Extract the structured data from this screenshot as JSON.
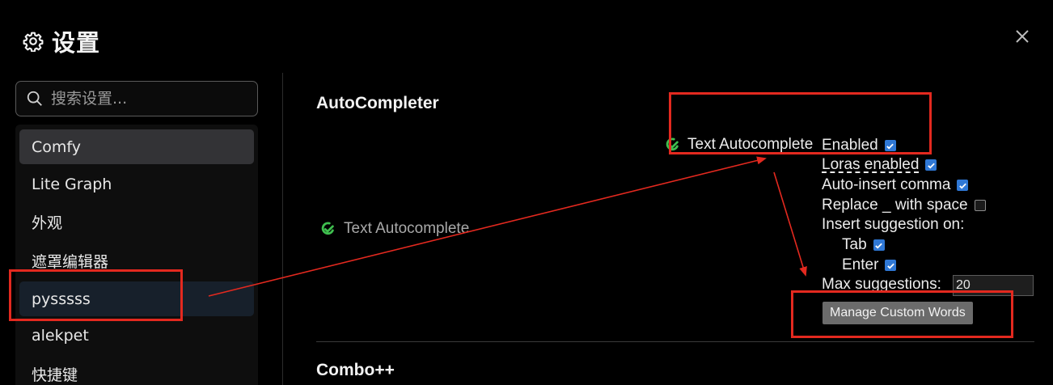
{
  "header": {
    "title": "设置",
    "close_icon": "close-icon",
    "gear_icon": "gear-icon"
  },
  "search": {
    "placeholder": "搜索设置...",
    "value": ""
  },
  "sidebar": {
    "items": [
      {
        "label": "Comfy",
        "state": "active"
      },
      {
        "label": "Lite Graph",
        "state": ""
      },
      {
        "label": "外观",
        "state": ""
      },
      {
        "label": "遮罩编辑器",
        "state": ""
      },
      {
        "label": "pysssss",
        "state": "selected"
      },
      {
        "label": "alekpet",
        "state": ""
      },
      {
        "label": "快捷键",
        "state": ""
      }
    ]
  },
  "main": {
    "section_autocompleter": "AutoCompleter",
    "section_combo": "Combo++",
    "setting_label": "Text Autocomplete",
    "inline_label": "Text Autocomplete",
    "options": {
      "enabled": {
        "label": "Enabled",
        "checked": true
      },
      "loras": {
        "label": "Loras enabled",
        "checked": true
      },
      "comma": {
        "label": "Auto-insert comma",
        "checked": true
      },
      "replace": {
        "label": "Replace _ with space",
        "checked": false
      },
      "insert_on": "Insert suggestion on:",
      "tab": {
        "label": "Tab",
        "checked": true
      },
      "enter": {
        "label": "Enter",
        "checked": true
      },
      "max_label": "Max suggestions:",
      "max_value": "20",
      "manage_button": "Manage Custom Words"
    }
  },
  "colors": {
    "annotation": "#e3291f",
    "checkbox": "#2f78d6",
    "logo": "#3fbf4f"
  }
}
